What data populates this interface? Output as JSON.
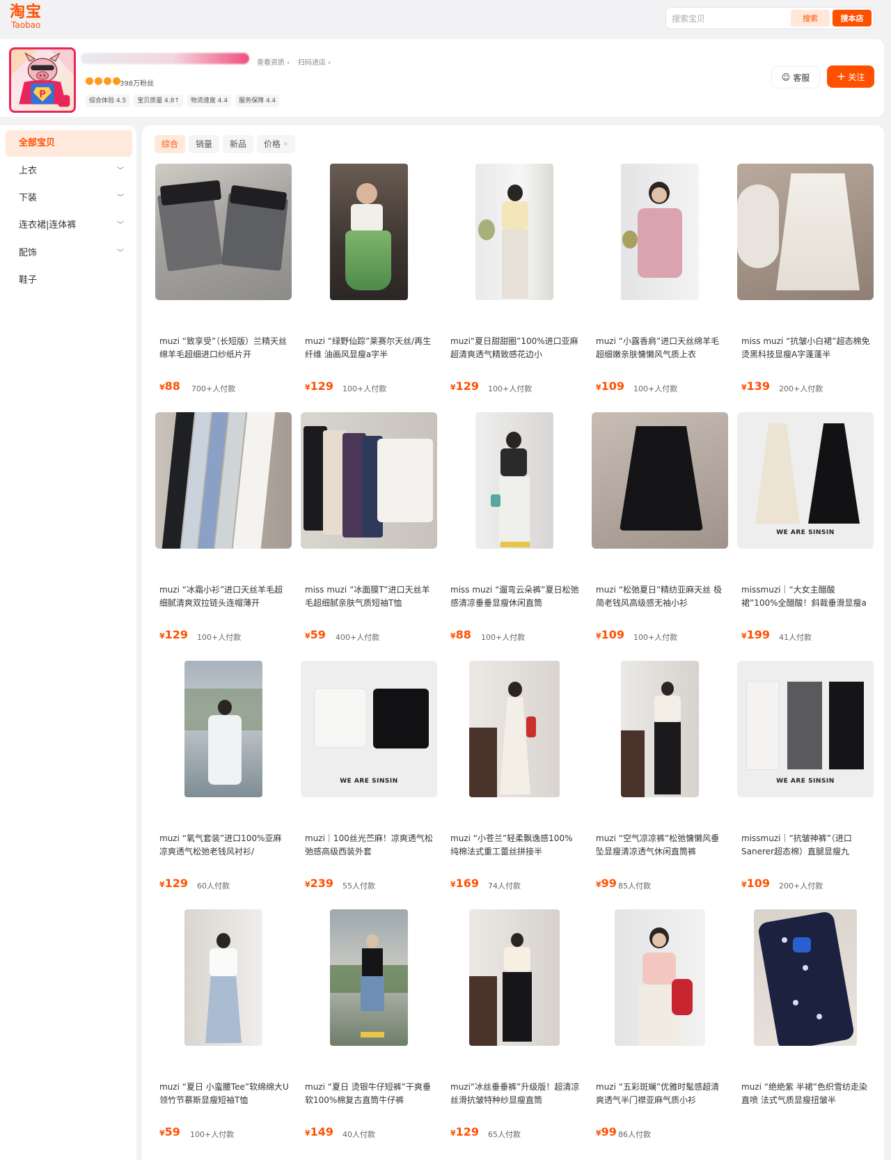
{
  "header": {
    "logo_cn": "淘宝",
    "logo_en": "Taobao",
    "search_placeholder": "搜索宝贝",
    "search_button": "搜索",
    "shop_search_button": "搜本店"
  },
  "shop": {
    "link_profile": "查看资质",
    "link_scan": "扫码进店",
    "fans": "398万粉丝",
    "scores": [
      "综合体验 4.5",
      "宝贝质量 4.8↑",
      "物流速度 4.4",
      "服务保障 4.4"
    ],
    "service_button": "客服",
    "follow_button": "关注"
  },
  "sidebar": {
    "items": [
      {
        "label": "全部宝贝"
      },
      {
        "label": "上衣"
      },
      {
        "label": "下装"
      },
      {
        "label": "连衣裙|连体裤"
      },
      {
        "label": "配饰"
      },
      {
        "label": "鞋子"
      }
    ]
  },
  "sort_tabs": [
    "综合",
    "销量",
    "新品",
    "价格"
  ],
  "products": [
    {
      "title": "muzi “致享受”（长短版）兰精天丝绵羊毛超细进口纱纸片开",
      "price": "88",
      "sold": "700+人付款"
    },
    {
      "title": "muzi “绿野仙踪”莱赛尔天丝/再生纤维 油画风显瘦a字半",
      "price": "129",
      "sold": "100+人付款"
    },
    {
      "title": "muzi“夏日甜甜圈”100%进口亚麻 超清爽透气精致感花边小",
      "price": "129",
      "sold": "100+人付款"
    },
    {
      "title": "muzi “小露香肩”进口天丝绵羊毛超细嫩亲肤慵懒风气质上衣",
      "price": "109",
      "sold": "100+人付款"
    },
    {
      "title": "miss muzi “抗皱小白裙”超态棉免烫黑科技显瘦A字蓬蓬半",
      "price": "139",
      "sold": "200+人付款"
    },
    {
      "title": "muzi “冰霜小衫”进口天丝羊毛超细腻清爽双拉链头连帽薄开",
      "price": "129",
      "sold": "100+人付款"
    },
    {
      "title": "miss muzi “冰面膜T”进口天丝羊毛超细腻亲肤气质短袖T恤",
      "price": "59",
      "sold": "400+人付款"
    },
    {
      "title": "miss muzi “遛弯云朵裤”夏日松弛感清凉垂垂显瘦休闲直筒",
      "price": "88",
      "sold": "100+人付款"
    },
    {
      "title": "muzi “松弛夏日”精纺亚麻天丝 极简老钱风高级感无袖小衫",
      "price": "109",
      "sold": "100+人付款"
    },
    {
      "title": "missmuzi｜“大女主醋酸裙”100%全醋酸！斜裁垂滑显瘦a",
      "price": "199",
      "sold": "41人付款"
    },
    {
      "title": "muzi “氧气套装”进口100%亚麻 凉爽透气松弛老钱风衬衫/",
      "price": "129",
      "sold": "60人付款"
    },
    {
      "title": "muzi｜100丝光苎麻！凉爽透气松弛感高级西装外套",
      "price": "239",
      "sold": "55人付款"
    },
    {
      "title": "muzi “小苍兰”轻柔飘逸感100%纯棉法式重工蕾丝拼接半",
      "price": "169",
      "sold": "74人付款"
    },
    {
      "title": "muzi “空气凉凉裤”松弛慵懒风垂坠显瘦清凉透气休闲直筒裤",
      "price": "99",
      "sold": "85人付款"
    },
    {
      "title": "missmuzi｜“抗皱神裤”（进口Sanerer超态棉）直腿显瘦九",
      "price": "109",
      "sold": "200+人付款"
    },
    {
      "title": "muzi “夏日 小蛮腰Tee”软绵绵大U领竹节慕斯显瘦短袖T恤",
      "price": "59",
      "sold": "100+人付款"
    },
    {
      "title": "muzi “夏日 烫银牛仔短裤”干爽垂软100%棉复古直筒牛仔裤",
      "price": "149",
      "sold": "40人付款"
    },
    {
      "title": "muzi“冰丝垂垂裤”升级版！超清凉丝滑抗皱特种纱显瘦直筒",
      "price": "129",
      "sold": "65人付款"
    },
    {
      "title": "muzi “五彩斑斓”优雅时髦感超清爽透气半门襟亚麻气质小衫",
      "price": "99",
      "sold": "86人付款"
    },
    {
      "title": "muzi “绝绝紫 半裙”色织雪纺走染直喷 法式气质显瘦扭皱半",
      "price": "",
      "sold": ""
    }
  ],
  "image_brand_text": "WE ARE SINSIN",
  "colors": {
    "accent": "#ff5000",
    "accent_light": "#ffe9dc",
    "avatar_border": "#e8265a"
  }
}
